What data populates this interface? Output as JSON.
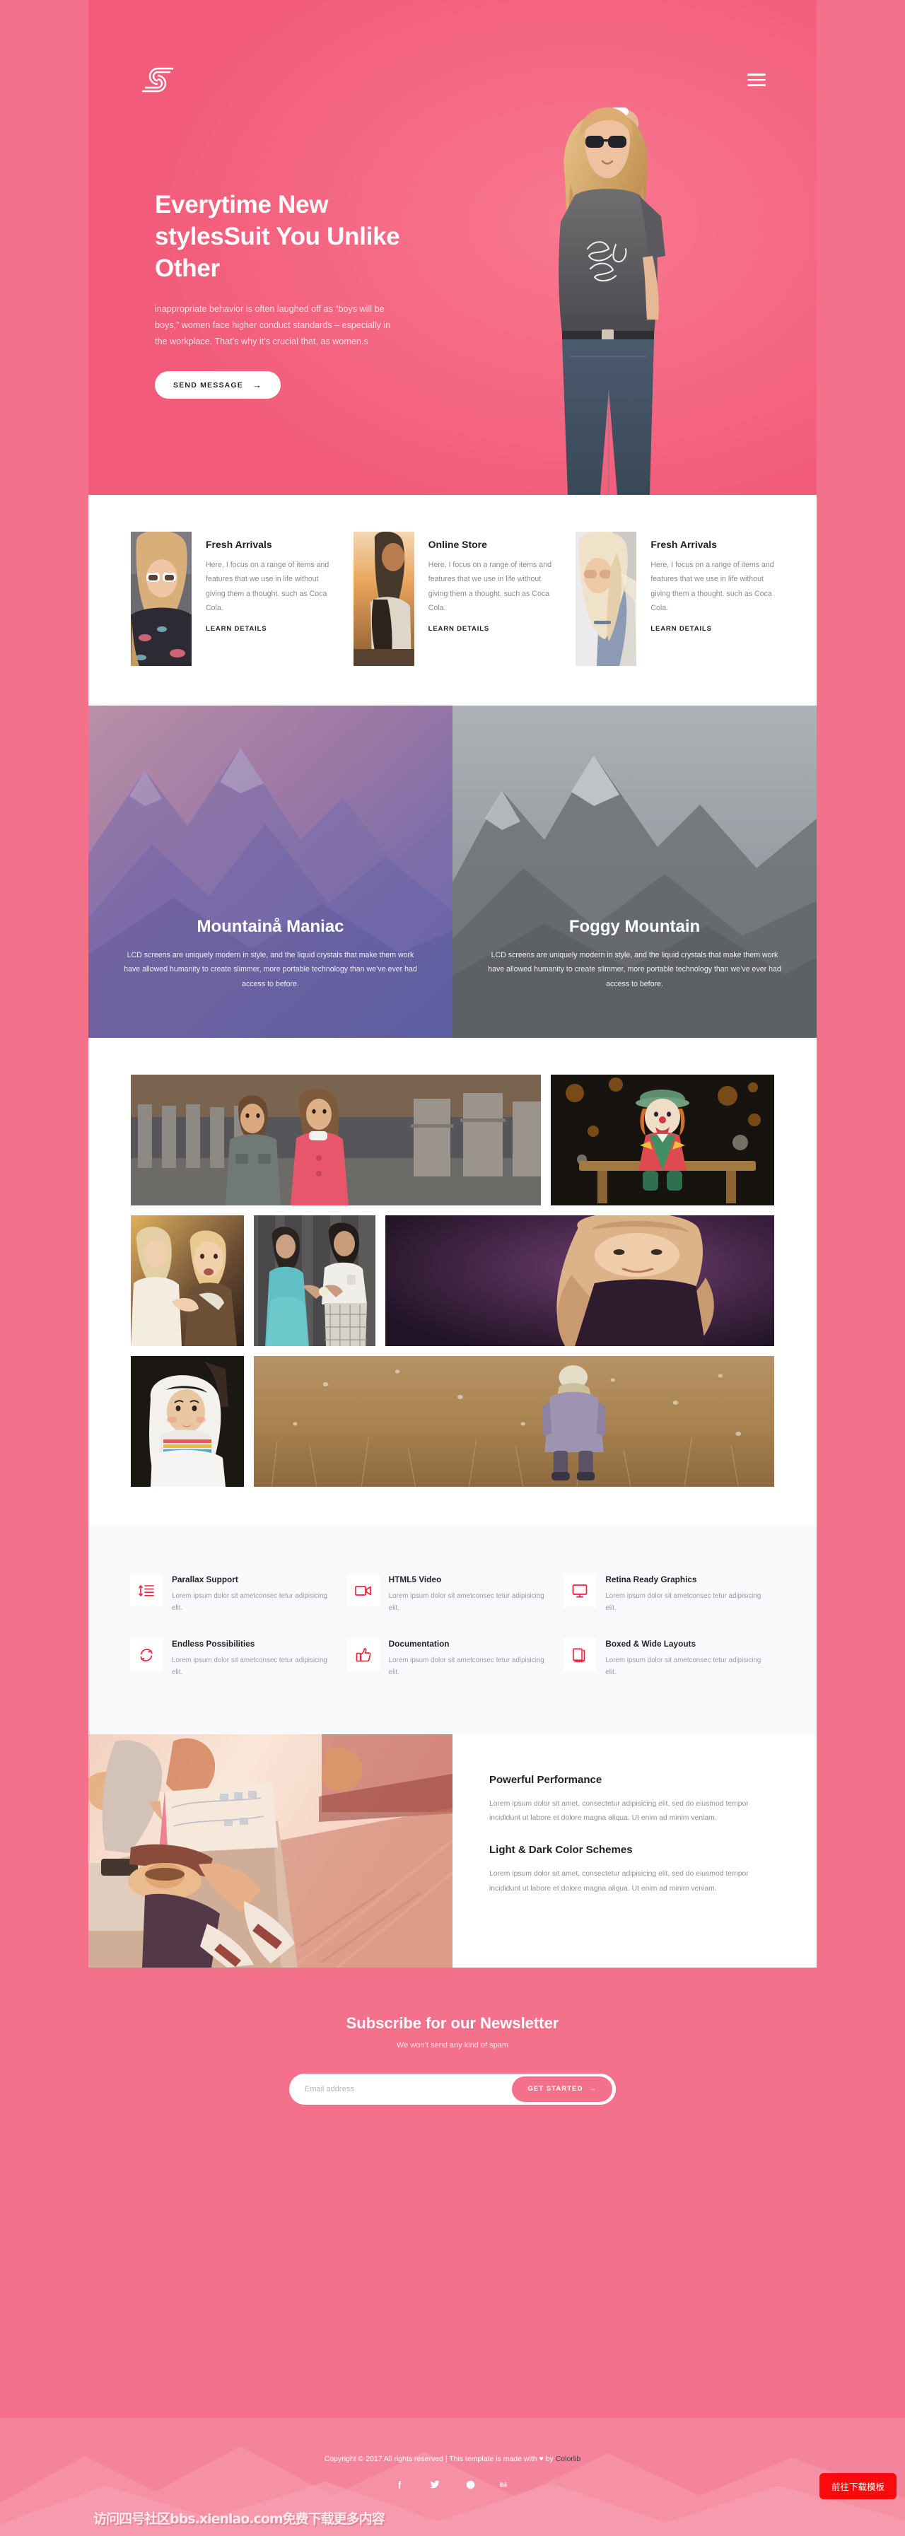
{
  "brand": {
    "logo_name": "s-logo",
    "menu_icon": "hamburger-menu-icon"
  },
  "hero": {
    "title": "Everytime New stylesSuit You Unlike Other",
    "subtitle": "inappropriate behavior is often laughed off as “boys will be boys,” women face higher conduct standards – especially in the workplace. That’s why it’s crucial that, as women.s",
    "cta_label": "SEND MESSAGE",
    "cta_icon": "arrow-right-icon",
    "bg_color": "#f4637f"
  },
  "cards": [
    {
      "title": "Fresh Arrivals",
      "text": "Here, I focus on a range of items and features that we use in life without giving them a thought. such as Coca Cola.",
      "link": "LEARN DETAILS",
      "thumb": "woman-white-sunglasses-photo"
    },
    {
      "title": "Online Store",
      "text": "Here, I focus on a range of items and features that we use in life without giving them a thought. such as Coca Cola.",
      "link": "LEARN DETAILS",
      "thumb": "woman-sunset-back-photo"
    },
    {
      "title": "Fresh Arrivals",
      "text": "Here, I focus on a range of items and features that we use in life without giving them a thought. such as Coca Cola.",
      "link": "LEARN DETAILS",
      "thumb": "blonde-woman-sunglasses-photo"
    }
  ],
  "split": [
    {
      "title": "Mountainå Maniac",
      "text": "LCD screens are uniquely modern in style, and the liquid crystals that make them work have allowed humanity to create slimmer, more portable technology than we’ve ever had access to before.",
      "image": "sunset-mountain-photo"
    },
    {
      "title": "Foggy Mountain",
      "text": "LCD screens are uniquely modern in style, and the liquid crystals that make them work have allowed humanity to create slimmer, more portable technology than we’ve ever had access to before.",
      "image": "foggy-mountain-photo"
    }
  ],
  "gallery": {
    "rows": [
      [
        {
          "name": "two-children-fence-photo"
        },
        {
          "name": "clown-doll-bench-photo"
        }
      ],
      [
        {
          "name": "girl-and-toddler-photo"
        },
        {
          "name": "boy-girl-flower-photo"
        },
        {
          "name": "long-hair-girl-purple-photo"
        }
      ],
      [
        {
          "name": "girl-white-hood-photo"
        },
        {
          "name": "child-in-field-photo"
        }
      ]
    ]
  },
  "features": [
    {
      "title": "Parallax Support",
      "text": "Lorem ipsum dolor sit ametconsec tetur adipisicing elit.",
      "icon": "parallax-lines-icon"
    },
    {
      "title": "HTML5 Video",
      "text": "Lorem ipsum dolor sit ametconsec tetur adipisicing elit.",
      "icon": "video-camera-icon"
    },
    {
      "title": "Retina Ready Graphics",
      "text": "Lorem ipsum dolor sit ametconsec tetur adipisicing elit.",
      "icon": "monitor-icon"
    },
    {
      "title": "Endless Possibilities",
      "text": "Lorem ipsum dolor sit ametconsec tetur adipisicing elit.",
      "icon": "refresh-cycle-icon"
    },
    {
      "title": "Documentation",
      "text": "Lorem ipsum dolor sit ametconsec tetur adipisicing elit.",
      "icon": "thumbs-up-icon"
    },
    {
      "title": "Boxed & Wide Layouts",
      "text": "Lorem ipsum dolor sit ametconsec tetur adipisicing elit.",
      "icon": "books-icon"
    }
  ],
  "features_accent": "#fa1f37",
  "performance": {
    "image": "couple-map-railway-photo",
    "blocks": [
      {
        "title": "Powerful Performance",
        "text": "Lorem ipsum dolor sit amet, consectetur adipisicing elit, sed do eiusmod tempor incididunt ut labore et dolore magna aliqua. Ut enim ad minim veniam."
      },
      {
        "title": "Light & Dark Color Schemes",
        "text": "Lorem ipsum dolor sit amet, consectetur adipisicing elit, sed do eiusmod tempor incididunt ut labore et dolore magna aliqua. Ut enim ad minim veniam."
      }
    ]
  },
  "newsletter": {
    "heading": "Subscribe for our Newsletter",
    "sub": "We won’t send any kind of spam",
    "placeholder": "Email address",
    "value": "",
    "button": "GET STARTED",
    "button_icon": "arrow-right-icon"
  },
  "footer": {
    "copyright_prefix": "Copyright © 2017 All rights reserved | This template is made with ",
    "heart": "♥",
    "copyright_mid": " by ",
    "brand": "Colorlib",
    "socials": [
      {
        "name": "facebook-icon"
      },
      {
        "name": "twitter-icon"
      },
      {
        "name": "dribbble-icon"
      },
      {
        "name": "behance-icon"
      }
    ]
  },
  "overlay": {
    "watermark": "访问四号社区bbs.xienlao.com免费下载更多内容",
    "download_badge": "前往下载模板",
    "badge_color": "#fa0a0a"
  }
}
